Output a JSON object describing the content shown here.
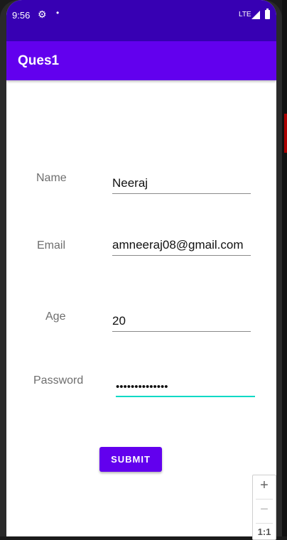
{
  "status_bar": {
    "time": "9:56",
    "gear_icon": "settings-gear",
    "dot": "•",
    "network": "LTE",
    "colors": {
      "background": "#3700b3"
    }
  },
  "app_bar": {
    "title": "Ques1",
    "color": "#6200ee"
  },
  "form": {
    "name_label": "Name",
    "name_value": "Neeraj",
    "email_label": "Email",
    "email_value": "amneeraj08@gmail.com",
    "age_label": "Age",
    "age_value": "20",
    "password_label": "Password",
    "password_value": "••••••••••••••",
    "submit_label": "SUBMIT"
  },
  "zoom_controls": {
    "plus": "+",
    "minus": "−",
    "reset": "1:1"
  }
}
